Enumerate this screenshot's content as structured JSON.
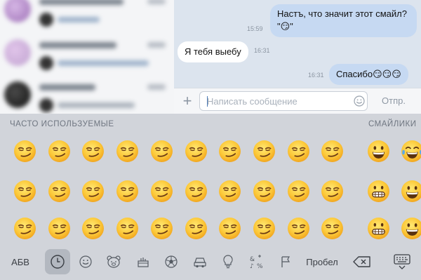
{
  "chat": {
    "messages": [
      {
        "dir": "out",
        "lines": [
          "Настъ, что значит этот смайл?",
          "\"😏\""
        ],
        "time": "15:59"
      },
      {
        "dir": "in",
        "lines": [
          "Я тебя выебу"
        ],
        "time": "16:31"
      },
      {
        "dir": "out",
        "lines": [
          "Спасибо😏😏😏"
        ],
        "time": "16:31"
      }
    ]
  },
  "composer": {
    "placeholder": "Написать сообщение",
    "send_label": "Отпр.",
    "plus_label": "+"
  },
  "keyboard": {
    "frequent_title": "ЧАСТО ИСПОЛЬЗУЕМЫЕ",
    "smileys_title": "СМАЙЛИКИ",
    "frequent_emoji_rows": 3,
    "frequent_emoji_cols": 10,
    "frequent_emoji": "smirking-face",
    "smileys_visible": [
      [
        "grinning-face",
        "tears-of-joy-face"
      ],
      [
        "grimacing-face",
        "grinning-face"
      ],
      [
        "grimacing-face",
        "grinning-face"
      ]
    ],
    "bottom_bar": {
      "abc_label": "АБВ",
      "space_label": "Пробел",
      "icons": [
        "recent-clock-icon",
        "smiley-icon",
        "animal-bear-icon",
        "food-cake-icon",
        "ball-icon",
        "car-icon",
        "lightbulb-icon",
        "symbols-icon",
        "flag-icon"
      ]
    }
  },
  "colors": {
    "outgoing_bubble": "#c6d9f2",
    "incoming_bubble": "#ffffff",
    "chat_background": "#dce4ee",
    "keyboard_background": "#d1d4da"
  }
}
